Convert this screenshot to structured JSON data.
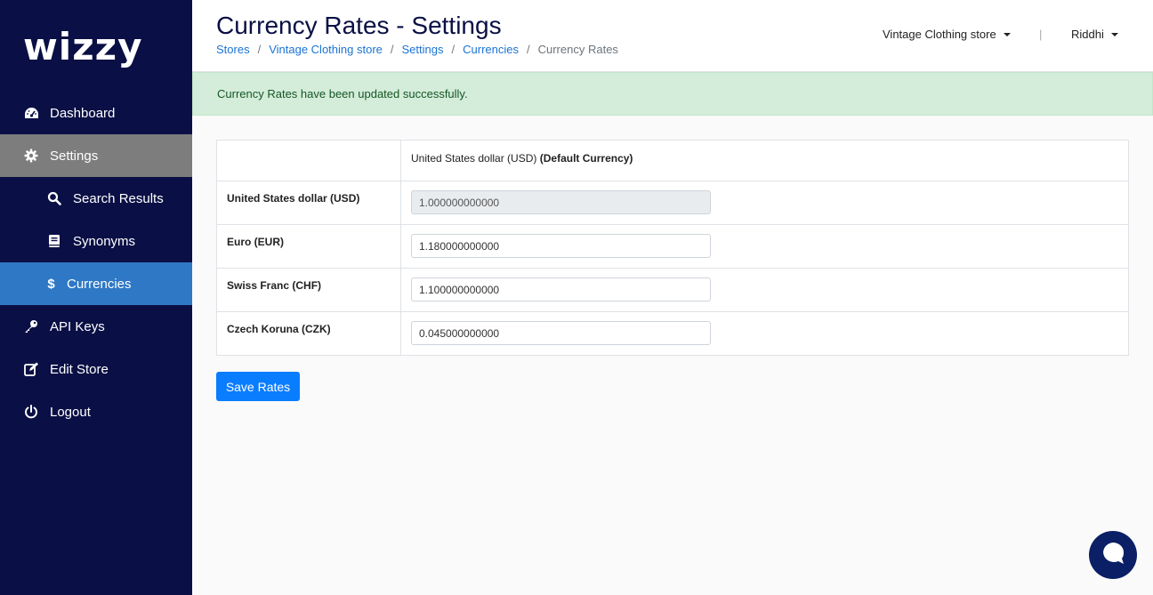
{
  "brand": {
    "logo_text": "wizzy"
  },
  "sidebar": {
    "items": [
      {
        "label": "Dashboard",
        "icon": "dashboard-gauge-icon"
      },
      {
        "label": "Settings",
        "icon": "gear-icon"
      },
      {
        "label": "Search Results",
        "icon": "search-icon"
      },
      {
        "label": "Synonyms",
        "icon": "book-icon"
      },
      {
        "label": "Currencies",
        "icon": "dollar-icon"
      },
      {
        "label": "API Keys",
        "icon": "key-icon"
      },
      {
        "label": "Edit Store",
        "icon": "edit-icon"
      },
      {
        "label": "Logout",
        "icon": "power-icon"
      }
    ]
  },
  "header": {
    "title": "Currency Rates - Settings",
    "breadcrumb": [
      "Stores",
      "Vintage Clothing store",
      "Settings",
      "Currencies",
      "Currency Rates"
    ],
    "breadcrumb_sep": "/",
    "store_selector": "Vintage Clothing store",
    "divider": "|",
    "user": "Riddhi"
  },
  "alert": {
    "message": "Currency Rates have been updated successfully."
  },
  "table": {
    "header_currency": "United States dollar (USD)",
    "header_default": "(Default Currency)",
    "rows": [
      {
        "label": "United States dollar (USD)",
        "value": "1.000000000000"
      },
      {
        "label": "Euro (EUR)",
        "value": "1.180000000000"
      },
      {
        "label": "Swiss Franc (CHF)",
        "value": "1.100000000000"
      },
      {
        "label": "Czech Koruna (CZK)",
        "value": "0.045000000000"
      }
    ]
  },
  "actions": {
    "save_label": "Save Rates"
  },
  "colors": {
    "sidebar_bg": "#0a1045",
    "active_item": "#2f78c5",
    "active_parent": "#7d7d7d",
    "primary_button": "#0a7dff",
    "alert_bg": "#d4ecda",
    "alert_text": "#155724"
  }
}
